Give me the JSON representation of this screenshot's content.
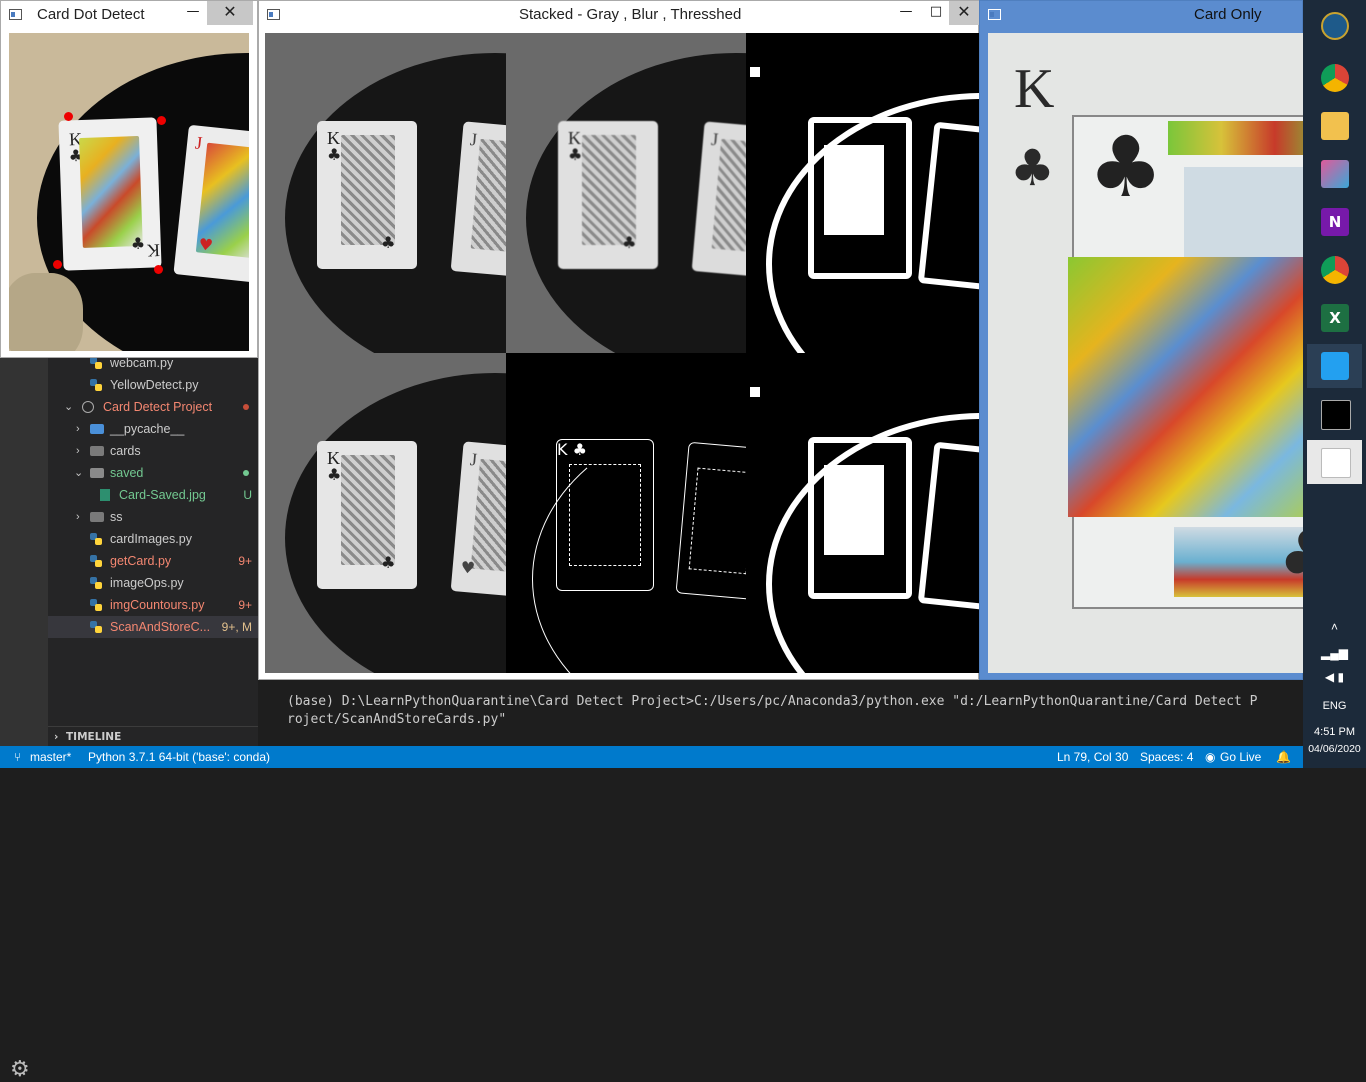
{
  "windows": {
    "card_dot": {
      "title": "Card Dot Detect"
    },
    "stacked": {
      "title": "Stacked - Gray , Blur , Thresshed"
    },
    "card_only": {
      "title": "Card Only"
    },
    "minimize_glyph": "—",
    "maximize_glyph": "□",
    "close_glyph": "✕"
  },
  "cards": {
    "king_rank": "K",
    "jack_rank": "J",
    "club": "♣",
    "heart": "♥"
  },
  "explorer": {
    "items": [
      {
        "label": "webcam.py",
        "type": "py"
      },
      {
        "label": "YellowDetect.py",
        "type": "py"
      },
      {
        "label": "Card Detect Project",
        "type": "project"
      },
      {
        "label": "__pycache__",
        "type": "folder-collapsed"
      },
      {
        "label": "cards",
        "type": "folder-collapsed"
      },
      {
        "label": "saved",
        "type": "folder-open"
      },
      {
        "label": "Card-Saved.jpg",
        "type": "image",
        "badge": "U"
      },
      {
        "label": "ss",
        "type": "folder-collapsed"
      },
      {
        "label": "cardImages.py",
        "type": "py"
      },
      {
        "label": "getCard.py",
        "type": "py",
        "badge": "9+"
      },
      {
        "label": "imageOps.py",
        "type": "py"
      },
      {
        "label": "imgCountours.py",
        "type": "py",
        "badge": "9+"
      },
      {
        "label": "ScanAndStoreC...",
        "type": "py",
        "badge": "9+, M"
      }
    ],
    "timeline_label": "TIMELINE"
  },
  "terminal": {
    "line1": "(base) D:\\LearnPythonQuarantine\\Card Detect Project>C:/Users/pc/Anaconda3/python.exe \"d:/LearnPythonQuarantine/Card Detect P",
    "line2": "roject/ScanAndStoreCards.py\""
  },
  "statusbar": {
    "branch": "master*",
    "interpreter": "Python 3.7.1 64-bit ('base': conda)",
    "position": "Ln 79, Col 30",
    "spaces": "Spaces: 4",
    "golive": "Go Live"
  },
  "taskbar": {
    "language": "ENG",
    "time": "4:51 PM",
    "date": "04/06/2020"
  },
  "colors": {
    "accent": "#007acc",
    "git_modified": "#e2c08d",
    "git_untracked": "#73c991",
    "error_red": "#f48771",
    "corner_marker": "#ee0000"
  }
}
